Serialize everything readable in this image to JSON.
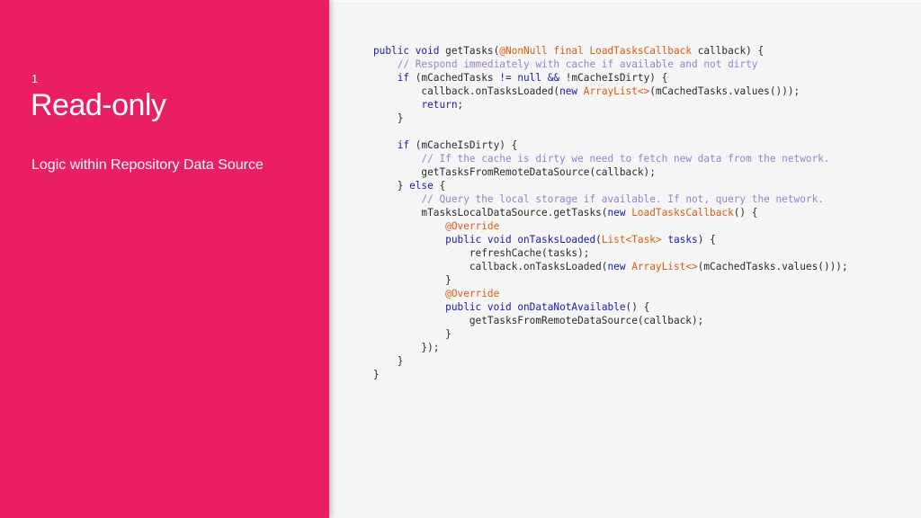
{
  "slide": {
    "number": "1",
    "title": "Read-only",
    "subtitle": "Logic within Repository Data Source"
  },
  "colors": {
    "accent": "#e91e63",
    "background": "#f5f5f5",
    "keyword": "#1a1ab8",
    "type": "#e8590c",
    "comment": "#9b7fd4",
    "text": "#2b2b2b"
  },
  "code": {
    "language": "java",
    "lines": [
      [
        [
          "kw",
          "public void "
        ],
        [
          "tx",
          "getTasks("
        ],
        [
          "an",
          "@NonNull final "
        ],
        [
          "ty",
          "LoadTasksCallback "
        ],
        [
          "tx",
          "callback) {"
        ]
      ],
      [
        [
          "tx",
          "    "
        ],
        [
          "cm",
          "// Respond immediately with cache if available and not dirty"
        ]
      ],
      [
        [
          "tx",
          "    "
        ],
        [
          "kw",
          "if "
        ],
        [
          "tx",
          "(mCachedTasks "
        ],
        [
          "kw",
          "!= null && "
        ],
        [
          "tx",
          "!mCacheIsDirty) {"
        ]
      ],
      [
        [
          "tx",
          "        callback.onTasksLoaded("
        ],
        [
          "kw",
          "new "
        ],
        [
          "ty",
          "ArrayList<>"
        ],
        [
          "tx",
          "(mCachedTasks.values()));"
        ]
      ],
      [
        [
          "tx",
          "        "
        ],
        [
          "kw",
          "return"
        ],
        [
          "tx",
          ";"
        ]
      ],
      [
        [
          "tx",
          "    }"
        ]
      ],
      [
        [
          "tx",
          ""
        ]
      ],
      [
        [
          "tx",
          "    "
        ],
        [
          "kw",
          "if "
        ],
        [
          "tx",
          "(mCacheIsDirty) {"
        ]
      ],
      [
        [
          "tx",
          "        "
        ],
        [
          "cm",
          "// If the cache is dirty we need to fetch new data from the network."
        ]
      ],
      [
        [
          "tx",
          "        getTasksFromRemoteDataSource(callback);"
        ]
      ],
      [
        [
          "tx",
          "    } "
        ],
        [
          "kw",
          "else "
        ],
        [
          "tx",
          "{"
        ]
      ],
      [
        [
          "tx",
          "        "
        ],
        [
          "cm",
          "// Query the local storage if available. If not, query the network."
        ]
      ],
      [
        [
          "tx",
          "        mTasksLocalDataSource.getTasks("
        ],
        [
          "kw",
          "new "
        ],
        [
          "ty",
          "LoadTasksCallback"
        ],
        [
          "tx",
          "() {"
        ]
      ],
      [
        [
          "tx",
          "            "
        ],
        [
          "an",
          "@Override"
        ]
      ],
      [
        [
          "tx",
          "            "
        ],
        [
          "kw",
          "public void "
        ],
        [
          "fn",
          "onTasksLoaded"
        ],
        [
          "tx",
          "("
        ],
        [
          "ty",
          "List<Task> "
        ],
        [
          "fn",
          "tasks"
        ],
        [
          "tx",
          ") {"
        ]
      ],
      [
        [
          "tx",
          "                refreshCache(tasks);"
        ]
      ],
      [
        [
          "tx",
          "                callback.onTasksLoaded("
        ],
        [
          "kw",
          "new "
        ],
        [
          "ty",
          "ArrayList<>"
        ],
        [
          "tx",
          "(mCachedTasks.values()));"
        ]
      ],
      [
        [
          "tx",
          "            }"
        ]
      ],
      [
        [
          "tx",
          "            "
        ],
        [
          "an",
          "@Override"
        ]
      ],
      [
        [
          "tx",
          "            "
        ],
        [
          "kw",
          "public void "
        ],
        [
          "fn",
          "onDataNotAvailable"
        ],
        [
          "tx",
          "() {"
        ]
      ],
      [
        [
          "tx",
          "                getTasksFromRemoteDataSource(callback);"
        ]
      ],
      [
        [
          "tx",
          "            }"
        ]
      ],
      [
        [
          "tx",
          "        });"
        ]
      ],
      [
        [
          "tx",
          "    }"
        ]
      ],
      [
        [
          "tx",
          "}"
        ]
      ]
    ]
  }
}
